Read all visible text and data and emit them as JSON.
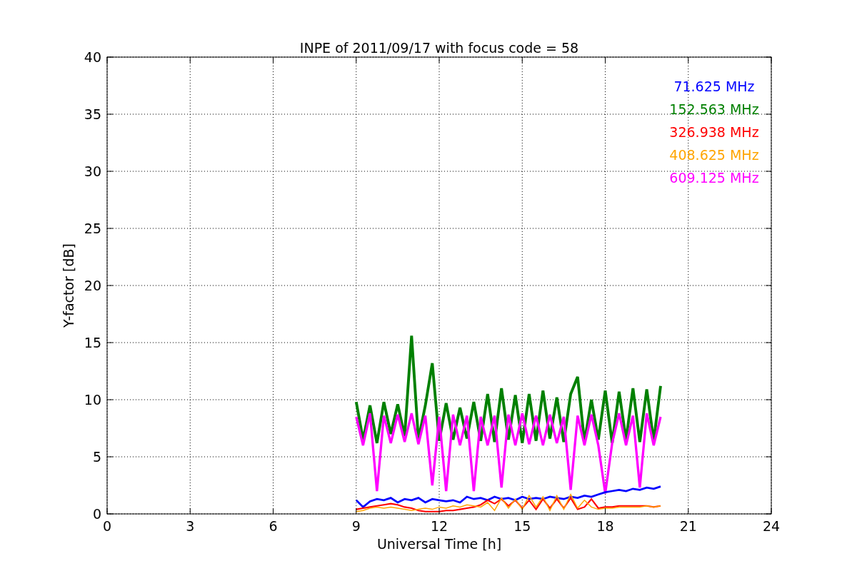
{
  "chart_data": {
    "type": "line",
    "grid": true,
    "title": "INPE of 2011/09/17 with focus code = 58",
    "xlabel": "Universal Time [h]",
    "ylabel": "Y-factor [dB]",
    "xlim": [
      0,
      24
    ],
    "ylim": [
      0,
      40
    ],
    "xticks": [
      0,
      3,
      6,
      9,
      12,
      15,
      18,
      21,
      24
    ],
    "yticks": [
      0,
      5,
      10,
      15,
      20,
      25,
      30,
      35,
      40
    ],
    "x": [
      9,
      9.25,
      9.5,
      9.75,
      10,
      10.25,
      10.5,
      10.75,
      11,
      11.25,
      11.5,
      11.75,
      12,
      12.25,
      12.5,
      12.75,
      13,
      13.25,
      13.5,
      13.75,
      14,
      14.25,
      14.5,
      14.75,
      15,
      15.25,
      15.5,
      15.75,
      16,
      16.25,
      16.5,
      16.75,
      17,
      17.25,
      17.5,
      17.75,
      18,
      18.25,
      18.5,
      18.75,
      19,
      19.25,
      19.5,
      19.75,
      20
    ],
    "series": [
      {
        "name": "71.625 MHz",
        "color": "#0000ff",
        "values": [
          1.2,
          0.6,
          1.1,
          1.3,
          1.2,
          1.4,
          1,
          1.3,
          1.2,
          1.4,
          1,
          1.3,
          1.2,
          1.1,
          1.2,
          1,
          1.5,
          1.3,
          1.4,
          1.2,
          1.5,
          1.3,
          1.4,
          1.2,
          1.5,
          1.3,
          1.4,
          1.3,
          1.5,
          1.4,
          1.3,
          1.5,
          1.4,
          1.6,
          1.5,
          1.7,
          1.9,
          2,
          2.1,
          2,
          2.2,
          2.1,
          2.3,
          2.2,
          2.4
        ]
      },
      {
        "name": "152.563 MHz",
        "color": "#008000",
        "values": [
          9.8,
          6.5,
          9.5,
          6.2,
          9.8,
          7,
          9.6,
          6.8,
          15.6,
          6.5,
          9.5,
          13.2,
          6.4,
          9.7,
          6.5,
          9.3,
          6.6,
          9.8,
          6.4,
          10.5,
          6.3,
          11,
          6.5,
          10.4,
          6.2,
          10.5,
          6.4,
          10.8,
          6.6,
          10.2,
          6.3,
          10.5,
          12,
          6.3,
          10,
          6.5,
          10.8,
          6.2,
          10.7,
          6.5,
          11,
          6.3,
          10.9,
          6.4,
          11.2
        ]
      },
      {
        "name": "326.938 MHz",
        "color": "#ff0000",
        "values": [
          0.4,
          0.5,
          0.6,
          0.7,
          0.8,
          0.9,
          0.8,
          0.6,
          0.5,
          0.3,
          0.2,
          0.2,
          0.2,
          0.3,
          0.3,
          0.4,
          0.5,
          0.6,
          0.8,
          1.2,
          0.9,
          1.3,
          0.7,
          1.2,
          0.5,
          1.2,
          0.4,
          1.3,
          0.5,
          1.3,
          0.5,
          1.4,
          0.4,
          0.6,
          1.3,
          0.5,
          0.6,
          0.6,
          0.7,
          0.7,
          0.7,
          0.7,
          0.7,
          0.6,
          0.7
        ]
      },
      {
        "name": "408.625 MHz",
        "color": "#ffa500",
        "values": [
          0.2,
          0.3,
          0.5,
          0.6,
          0.5,
          0.6,
          0.5,
          0.4,
          0.3,
          0.4,
          0.5,
          0.4,
          0.6,
          0.5,
          0.7,
          0.6,
          0.8,
          0.7,
          0.6,
          1,
          0.3,
          1.4,
          0.5,
          1.3,
          0.4,
          1.6,
          0.6,
          1.5,
          0.3,
          1.6,
          0.4,
          1.7,
          0.5,
          1.2,
          0.6,
          0.4,
          0.5,
          0.5,
          0.6,
          0.6,
          0.6,
          0.6,
          0.7,
          0.6,
          0.7
        ]
      },
      {
        "name": "609.125 MHz",
        "color": "#ff00ff",
        "values": [
          8.5,
          6,
          8.8,
          2,
          8.6,
          6.2,
          8.7,
          6.3,
          8.8,
          6.1,
          8.6,
          2.5,
          8.5,
          2,
          8.7,
          6,
          8.6,
          2,
          8.5,
          6,
          8.6,
          2.3,
          8.7,
          6,
          8.8,
          6.1,
          8.6,
          6,
          8.7,
          6.2,
          8.5,
          2.1,
          8.6,
          6,
          8.7,
          6,
          1.8,
          6.2,
          8.8,
          6,
          8.6,
          2.3,
          8.8,
          6,
          8.5
        ]
      }
    ]
  }
}
